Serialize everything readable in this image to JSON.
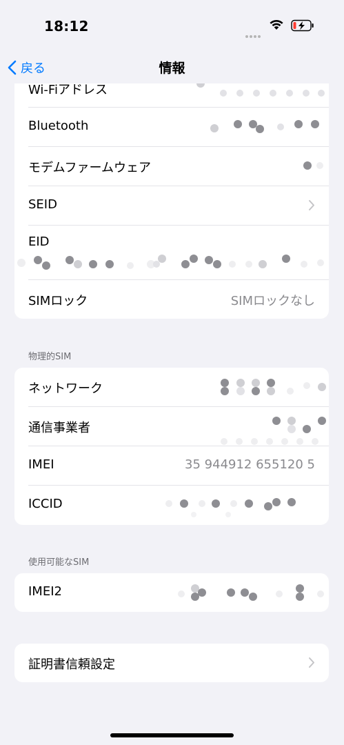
{
  "status": {
    "time": "18:12"
  },
  "nav": {
    "back_label": "戻る",
    "title": "情報"
  },
  "top_group": {
    "rows": [
      {
        "label": "Wi-Fiアドレス",
        "value": ""
      },
      {
        "label": "Bluetooth",
        "value": ""
      },
      {
        "label": "モデムファームウェア",
        "value": ""
      },
      {
        "label": "SEID",
        "value": ""
      },
      {
        "label": "EID",
        "value": ""
      },
      {
        "label": "SIMロック",
        "value": "SIMロックなし"
      }
    ]
  },
  "physical_sim": {
    "header": "物理的SIM",
    "rows": [
      {
        "label": "ネットワーク",
        "value": ""
      },
      {
        "label": "通信事業者",
        "value": ""
      },
      {
        "label": "IMEI",
        "value": "35 944912 655120 5"
      },
      {
        "label": "ICCID",
        "value": ""
      }
    ]
  },
  "available_sim": {
    "header": "使用可能なSIM",
    "rows": [
      {
        "label": "IMEI2",
        "value": ""
      }
    ]
  },
  "cert_group": {
    "rows": [
      {
        "label": "証明書信頼設定"
      }
    ]
  },
  "colors": {
    "accent": "#007aff",
    "background": "#f2f2f7",
    "secondary_text": "#8a8a8e",
    "battery_low": "#ff3b30"
  },
  "icons": [
    "chevron-left-icon",
    "wifi-icon",
    "battery-charging-icon",
    "chevron-right-icon"
  ]
}
